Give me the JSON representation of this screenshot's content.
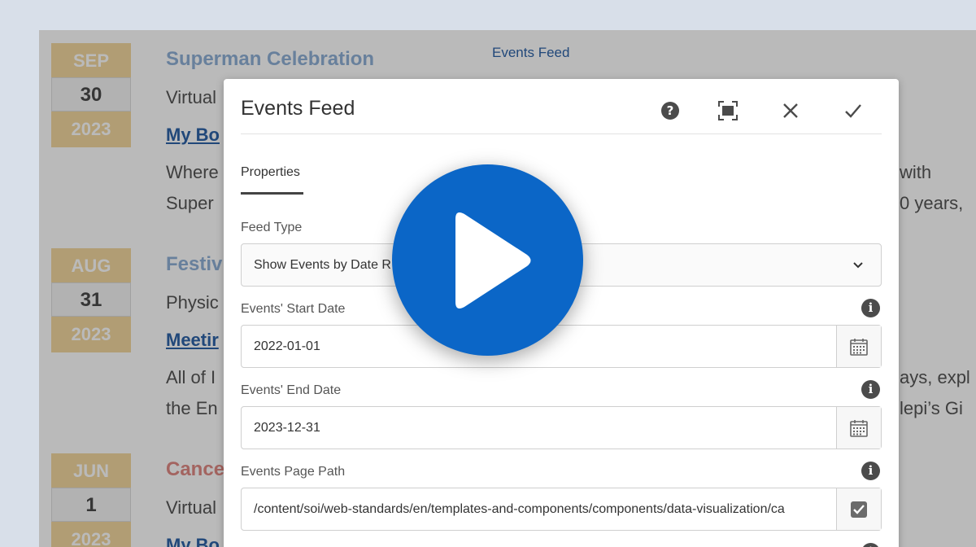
{
  "page": {
    "feed_label": "Events Feed",
    "events": [
      {
        "month": "SEP",
        "day": "30",
        "year": "2023",
        "title": "Superman Celebration",
        "title_color": "#8fb0d6",
        "type": "Virtual",
        "link": "My Bo",
        "desc_line1": "Where",
        "desc_line2": "Super",
        "desc_right1": "with",
        "desc_right2": "0 years,"
      },
      {
        "month": "AUG",
        "day": "31",
        "year": "2023",
        "title": "Festiv",
        "title_color": "#8fb0d6",
        "type": "Physic",
        "link": "Meetir",
        "desc_line1": "All of I",
        "desc_line2": "the En",
        "desc_right1": "ays, expl",
        "desc_right2": "lepi’s Gi"
      },
      {
        "month": "JUN",
        "day": "1",
        "year": "2023",
        "title": "Cance",
        "title_color": "#e08a84",
        "type": "Virtual",
        "link": "My Bo",
        "desc_line1": "",
        "desc_line2": "",
        "desc_right1": "",
        "desc_right2": ""
      }
    ]
  },
  "dialog": {
    "title": "Events Feed",
    "help_icon": "question-circle-icon",
    "fullscreen_icon": "fullscreen-icon",
    "close_icon": "close-icon",
    "done_icon": "checkmark-icon",
    "tab": "Properties",
    "fields": {
      "feed_type": {
        "label": "Feed Type",
        "value": "Show Events by Date R"
      },
      "start_date": {
        "label": "Events' Start Date",
        "value": "2022-01-01"
      },
      "end_date": {
        "label": "Events' End Date",
        "value": "2023-12-31"
      },
      "page_path": {
        "label": "Events Page Path",
        "value": "/content/soi/web-standards/en/templates-and-components/components/data-visualization/ca"
      }
    }
  },
  "play_button": {
    "icon": "play-icon",
    "color": "#0b66c7"
  }
}
